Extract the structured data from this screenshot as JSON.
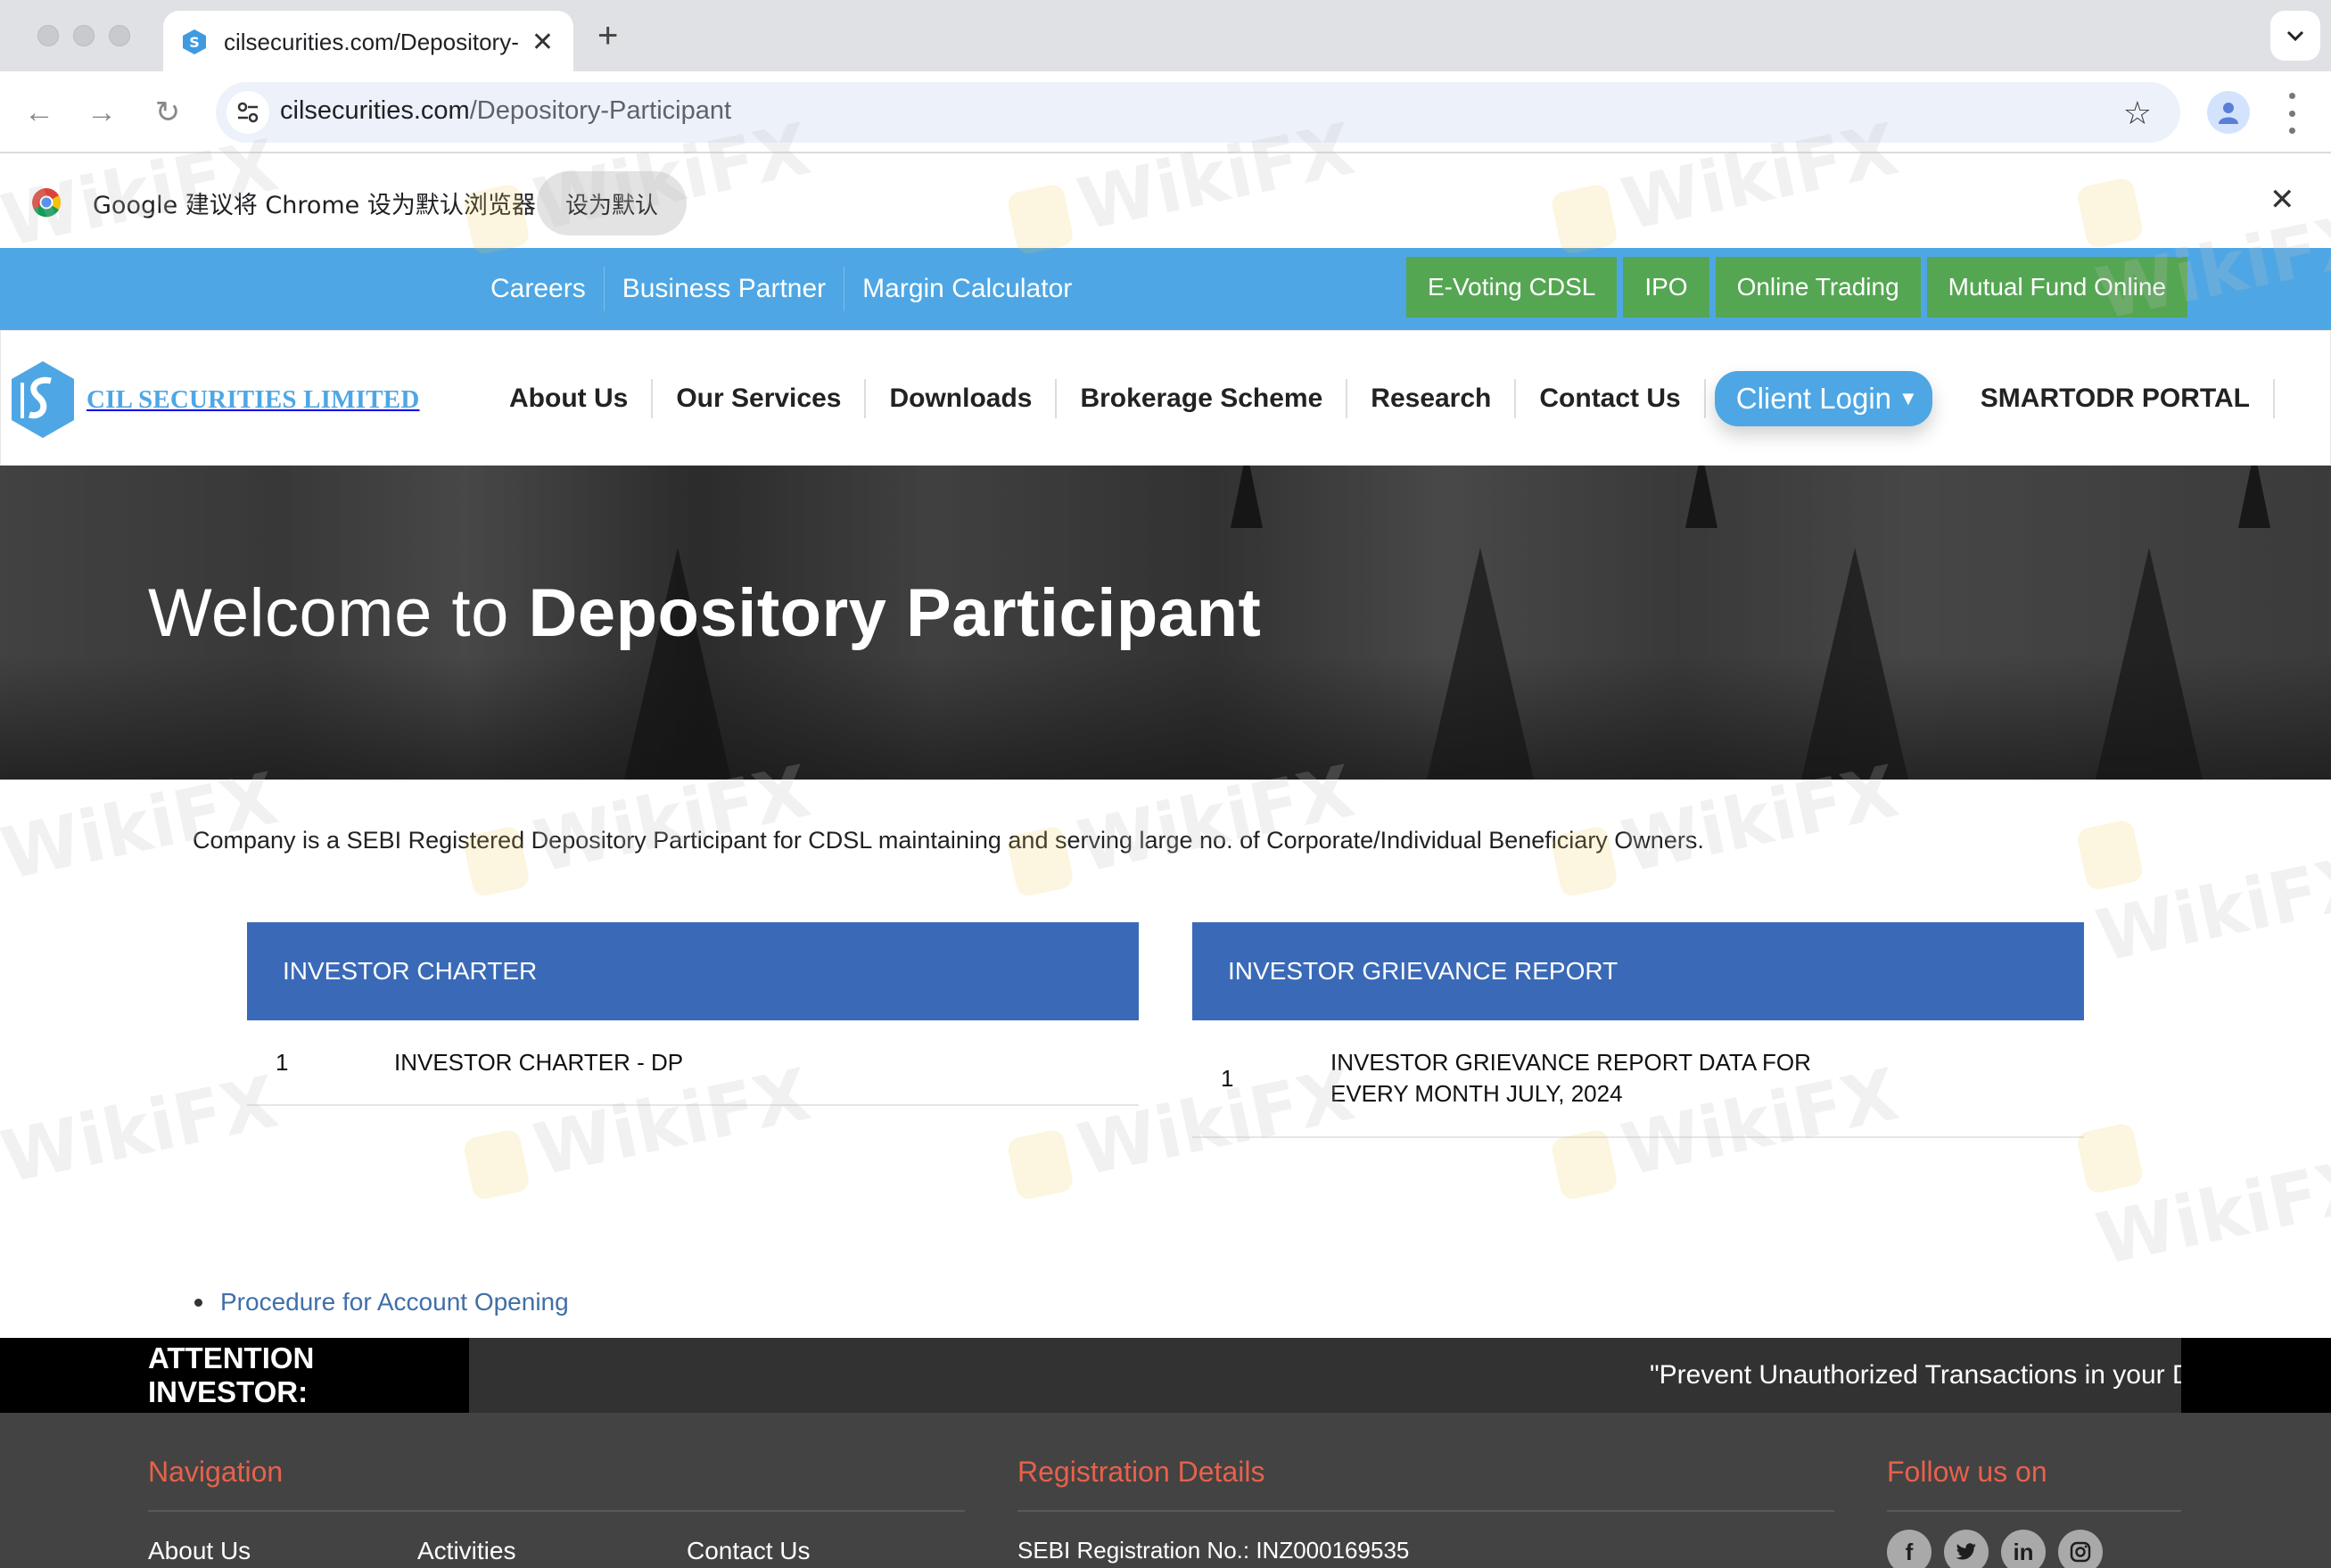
{
  "browser": {
    "tab_title": "cilsecurities.com/Depository-",
    "url_host": "cilsecurities.com",
    "url_path": "/Depository-Participant",
    "infobar_message": "Google 建议将 Chrome 设为默认浏览器",
    "infobar_button": "设为默认",
    "icons": {
      "back": "arrow-left-icon",
      "forward": "arrow-right-icon",
      "reload": "reload-icon",
      "site_info": "tune-icon",
      "bookmark": "star-icon",
      "profile": "profile-icon",
      "menu": "kebab-menu-icon",
      "new_tab": "plus-icon",
      "tab_search": "chevron-down-icon"
    }
  },
  "topbar": {
    "links": [
      "Careers",
      "Business Partner",
      "Margin Calculator"
    ],
    "buttons": [
      "E-Voting CDSL",
      "IPO",
      "Online Trading",
      "Mutual Fund Online"
    ]
  },
  "header": {
    "logo_text": "CIL SECURITIES LIMITED",
    "nav": [
      "About Us",
      "Our Services",
      "Downloads",
      "Brokerage Scheme",
      "Research",
      "Contact Us"
    ],
    "client_login": "Client Login",
    "smartodr": "SMARTODR PORTAL"
  },
  "hero": {
    "title_prefix": "Welcome to",
    "title_bold": "Depository Participant"
  },
  "main": {
    "intro": "Company is a SEBI Registered Depository Participant for CDSL maintaining and serving large no. of Corporate/Individual Beneficiary Owners.",
    "panels": [
      {
        "header": "INVESTOR CHARTER",
        "rows": [
          {
            "num": "1",
            "text": "INVESTOR CHARTER - DP"
          }
        ]
      },
      {
        "header": "INVESTOR GRIEVANCE REPORT",
        "rows": [
          {
            "num": "1",
            "line1": "INVESTOR GRIEVANCE REPORT DATA FOR",
            "line2": "EVERY MONTH JULY, 2024"
          }
        ]
      }
    ],
    "procedure_link": "Procedure for Account Opening"
  },
  "attention": {
    "label": "ATTENTION INVESTOR:",
    "ticker": "\"Prevent Unauthorized Transactions in your D"
  },
  "footer": {
    "navigation_title": "Navigation",
    "navigation_links": [
      "About Us",
      "Activities",
      "Contact Us"
    ],
    "registration_title": "Registration Details",
    "sebi_registration": "SEBI Registration No.: INZ000169535",
    "follow_title": "Follow us on",
    "social": [
      {
        "name": "facebook-icon",
        "glyph": "f"
      },
      {
        "name": "twitter-icon",
        "glyph": "t"
      },
      {
        "name": "linkedin-icon",
        "glyph": "in"
      },
      {
        "name": "instagram-icon",
        "glyph": "◎"
      }
    ]
  },
  "colors": {
    "topbar_blue": "#4ea7e4",
    "green_button": "#55a653",
    "panel_header": "#3a6ab7",
    "footer_heading": "#e8614a",
    "link_blue": "#3f6fa8"
  }
}
